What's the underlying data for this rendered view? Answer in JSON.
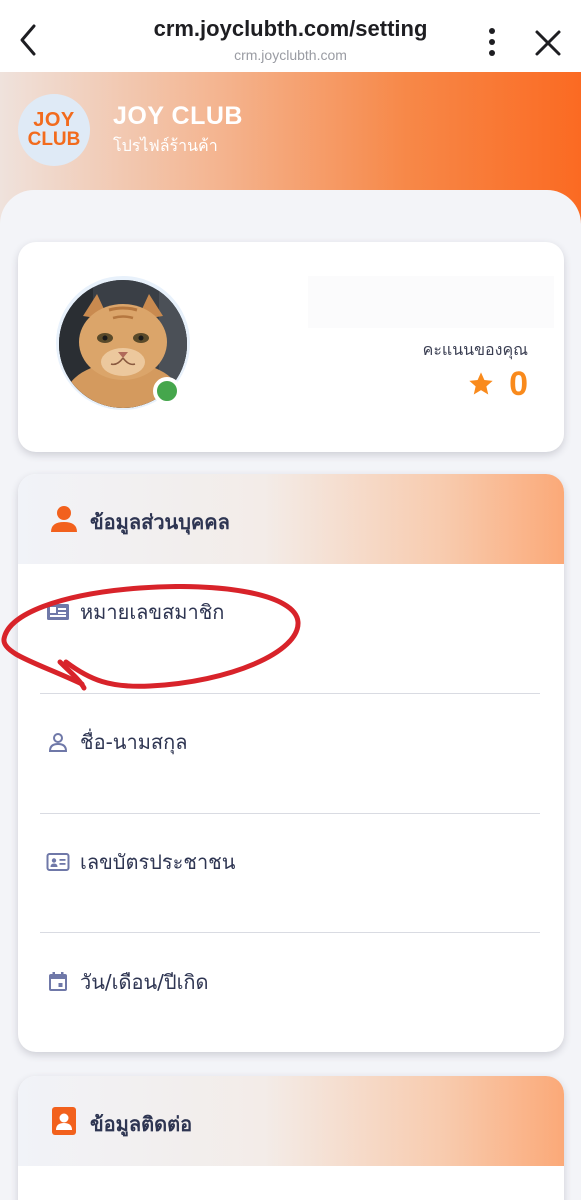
{
  "browser": {
    "url": "crm.joyclubth.com/setting",
    "domain": "crm.joyclubth.com"
  },
  "header": {
    "logo_top": "JOY",
    "logo_bottom": "CLUB",
    "brand_name": "JOY CLUB",
    "subtitle": "โปรไฟล์ร้านค้า",
    "accent_color": "#fb6a22"
  },
  "profile": {
    "display_name": "",
    "points_label": "คะแนนของคุณ",
    "points": "0",
    "status": "online",
    "status_color": "#45a64c"
  },
  "personal_section": {
    "title": "ข้อมูลส่วนบุคคล",
    "fields": [
      {
        "label": "หมายเลขสมาชิก",
        "value": "",
        "icon": "member-card-icon"
      },
      {
        "label": "ชื่อ-นามสกุล",
        "value": "",
        "icon": "person-outline-icon"
      },
      {
        "label": "เลขบัตรประชาชน",
        "value": "",
        "icon": "id-card-icon"
      },
      {
        "label": "วัน/เดือน/ปีเกิด",
        "value": "",
        "icon": "calendar-icon"
      }
    ]
  },
  "contact_section": {
    "title": "ข้อมูลติดต่อ"
  },
  "icons": {
    "back": "back-chevron-icon",
    "more": "more-vertical-icon",
    "close": "close-icon",
    "section_person": "person-icon",
    "section_contact": "contact-book-icon",
    "points": "star-icon"
  },
  "colors": {
    "section_icon": "#f2611d",
    "field_icon": "#6f78a8",
    "star": "#f98a1c",
    "annotation": "#d8232a"
  }
}
